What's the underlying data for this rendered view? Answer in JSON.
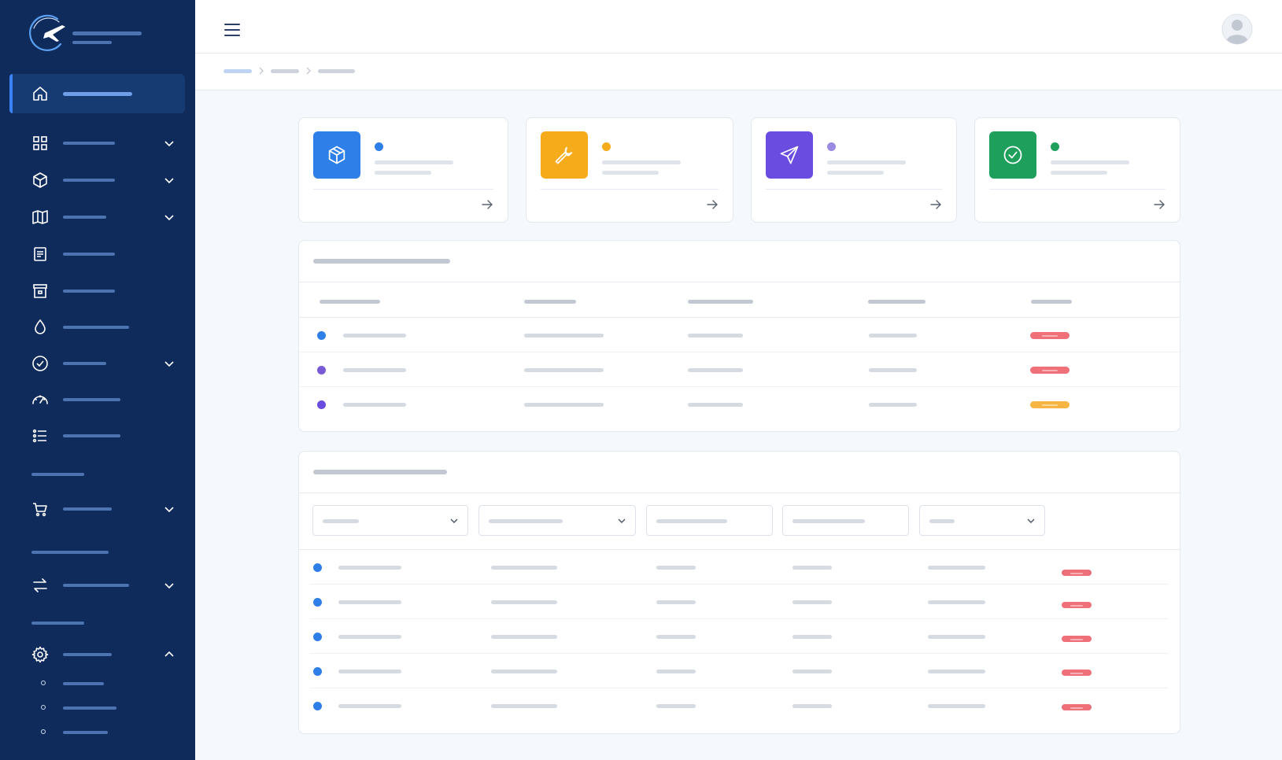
{
  "app": {
    "brand_icon": "airplane-orbit-logo",
    "accent": "#3b82f6",
    "sidebar_bg": "#0f2b5c"
  },
  "sidebar": {
    "items": [
      {
        "icon": "home-icon",
        "active": true,
        "expandable": false
      },
      {
        "icon": "grid-icon",
        "active": false,
        "expandable": true
      },
      {
        "icon": "cube-icon",
        "active": false,
        "expandable": true
      },
      {
        "icon": "map-icon",
        "active": false,
        "expandable": true
      },
      {
        "icon": "document-icon",
        "active": false,
        "expandable": false
      },
      {
        "icon": "archive-icon",
        "active": false,
        "expandable": false
      },
      {
        "icon": "droplet-icon",
        "active": false,
        "expandable": false
      },
      {
        "icon": "check-circle-icon",
        "active": false,
        "expandable": true
      },
      {
        "icon": "gauge-icon",
        "active": false,
        "expandable": false
      },
      {
        "icon": "list-icon",
        "active": false,
        "expandable": false
      },
      {
        "icon": "cart-icon",
        "active": false,
        "expandable": true
      },
      {
        "icon": "transfer-icon",
        "active": false,
        "expandable": true
      },
      {
        "icon": "gear-icon",
        "active": false,
        "expandable": true,
        "expanded": true
      }
    ]
  },
  "header": {
    "menu_icon": "hamburger-icon",
    "avatar_icon": "user-avatar-icon"
  },
  "summary_cards": [
    {
      "icon": "package-icon",
      "color": "#2f7fe8",
      "dot_color": "#2f7fe8"
    },
    {
      "icon": "wrench-icon",
      "color": "#f6ab1a",
      "dot_color": "#f6ab1a"
    },
    {
      "icon": "send-icon",
      "color": "#6a4de0",
      "dot_color": "#9b8be2"
    },
    {
      "icon": "check-circle-icon",
      "color": "#1f9f5c",
      "dot_color": "#1f9f5c"
    }
  ],
  "table1": {
    "rows": [
      {
        "dot_color": "#2f7fe8",
        "badge_color": "#f0707a"
      },
      {
        "dot_color": "#7a5bd6",
        "badge_color": "#f0707a"
      },
      {
        "dot_color": "#6a4de0",
        "badge_color": "#f7b544"
      }
    ]
  },
  "table2": {
    "filters": [
      "select",
      "select",
      "input",
      "input",
      "select"
    ],
    "rows": [
      {
        "dot_color": "#2f7fe8",
        "badge_color": "#f0707a"
      },
      {
        "dot_color": "#2f7fe8",
        "badge_color": "#f0707a"
      },
      {
        "dot_color": "#2f7fe8",
        "badge_color": "#f0707a"
      },
      {
        "dot_color": "#2f7fe8",
        "badge_color": "#f0707a"
      },
      {
        "dot_color": "#2f7fe8",
        "badge_color": "#f0707a"
      }
    ]
  }
}
